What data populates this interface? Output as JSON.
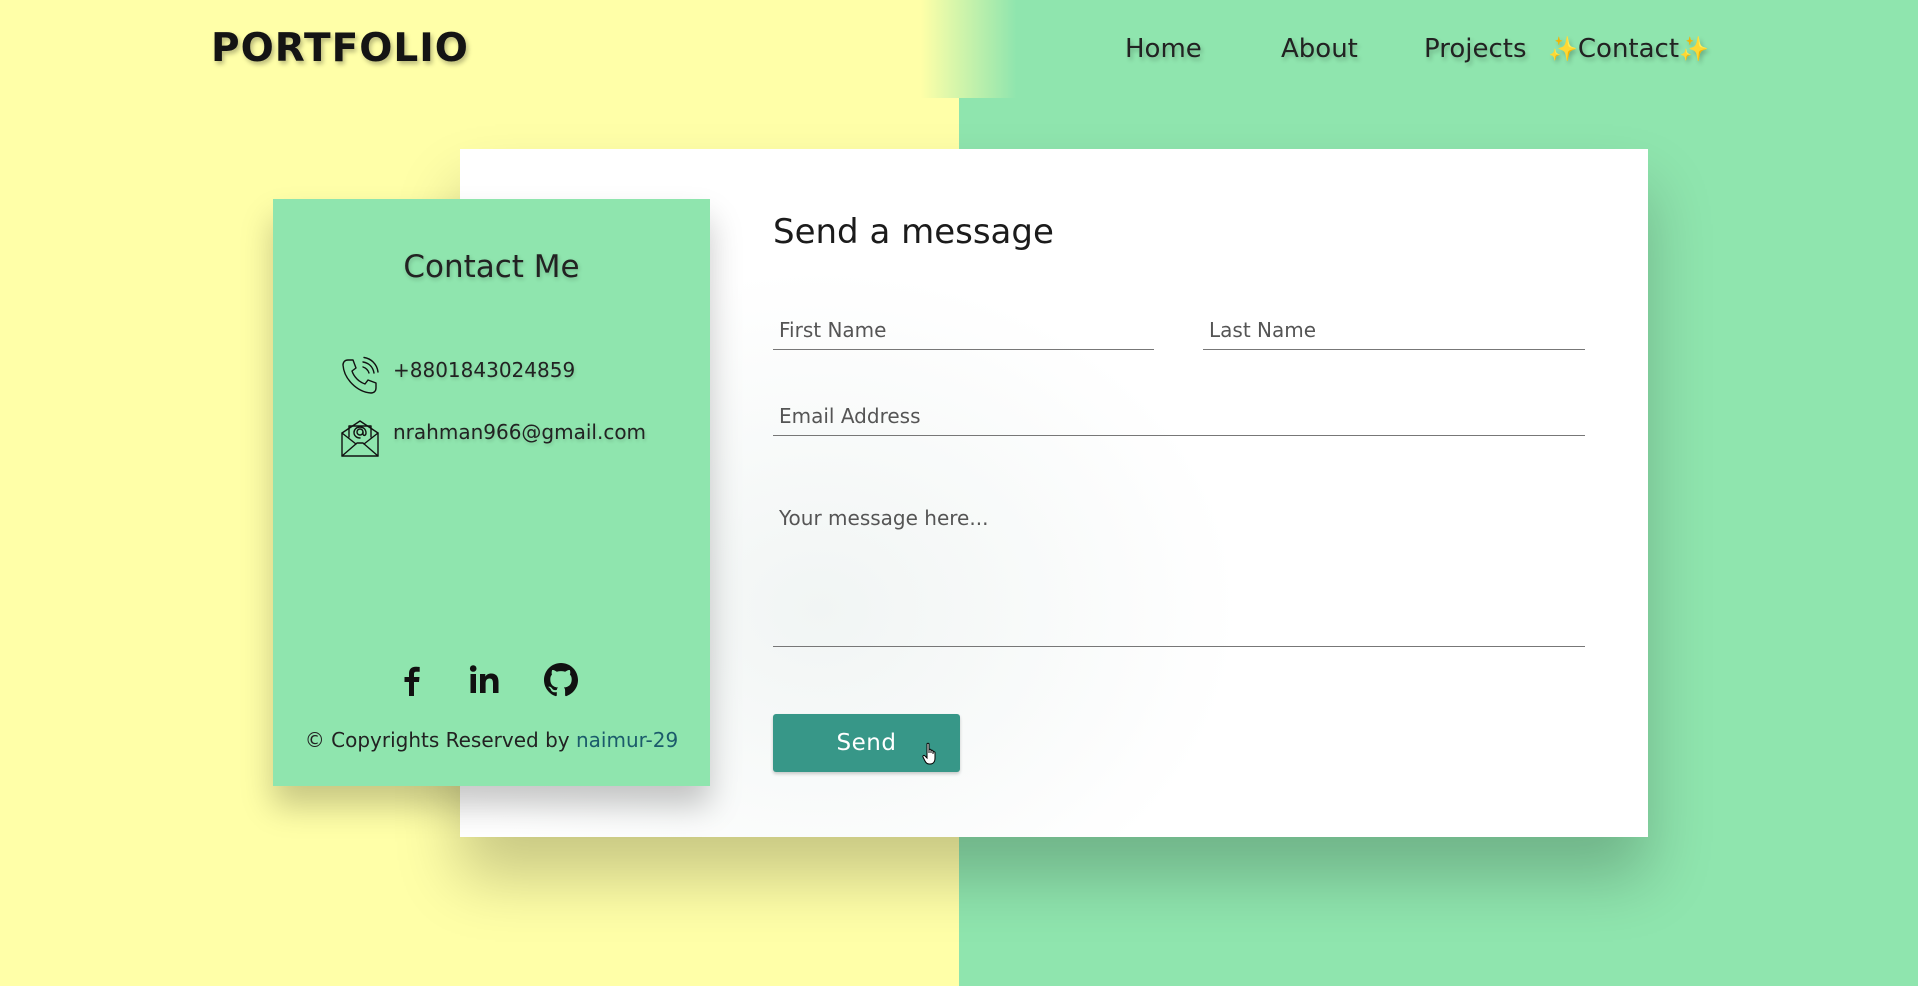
{
  "header": {
    "logo": "PORTFOLIO",
    "nav": {
      "home": "Home",
      "about": "About",
      "projects": "Projects",
      "contact": "Contact",
      "contact_sparkle": "✨"
    }
  },
  "contact_info": {
    "title": "Contact Me",
    "phone": "+8801843024859",
    "email": "nrahman966@gmail.com",
    "socials": [
      "facebook-icon",
      "linkedin-icon",
      "github-icon"
    ],
    "copyright_prefix": "© Copyrights Reserved by",
    "copyright_author": "naimur-29"
  },
  "form": {
    "title": "Send a message",
    "first_name_placeholder": "First Name",
    "last_name_placeholder": "Last Name",
    "email_placeholder": "Email Address",
    "message_placeholder": "Your message here...",
    "send_label": "Send"
  },
  "colors": {
    "yellow_bg": "#ffffa8",
    "green_bg": "#8fe5ae",
    "button": "#379788",
    "link": "#1b5b6b"
  }
}
